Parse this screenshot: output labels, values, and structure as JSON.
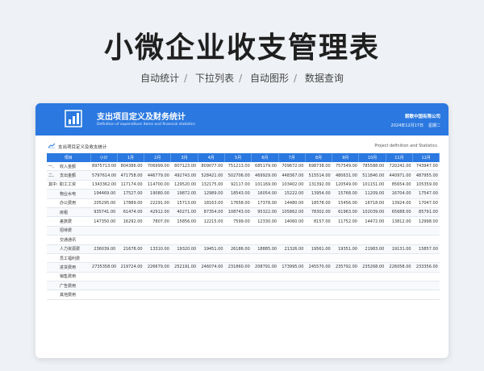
{
  "header": {
    "title": "小微企业收支管理表",
    "features": [
      "自动统计",
      "下拉列表",
      "自动图形",
      "数据查询"
    ]
  },
  "banner": {
    "title_zh": "支出项目定义及财务统计",
    "title_en": "Definition of expenditure items and financial statistics",
    "company": "朝歌中国有限公司",
    "date": "2024年12月17日",
    "weekday": "星期二"
  },
  "section": {
    "title_zh": "支出项目定义及收支统计",
    "title_en": "Project definition and Statistics"
  },
  "table": {
    "columns": [
      "项目",
      "小计",
      "1月",
      "2月",
      "3月",
      "4月",
      "5月",
      "6月",
      "7月",
      "8月",
      "9月",
      "10月",
      "11月",
      "12月"
    ],
    "rows": [
      {
        "group": "一、",
        "item": "收入金额",
        "values": [
          "8975713.00",
          "804386.00",
          "706999.00",
          "807123.00",
          "809077.00",
          "751213.00",
          "685179.00",
          "709672.00",
          "698738.00",
          "757549.00",
          "785588.00",
          "720242.00",
          "743947.00"
        ]
      },
      {
        "group": "二、",
        "item": "支出金额",
        "values": [
          "5797614.00",
          "471758.00",
          "446779.00",
          "492743.00",
          "528421.00",
          "502706.00",
          "469929.00",
          "448367.00",
          "515514.00",
          "480631.00",
          "511840.00",
          "440971.00",
          "487955.00"
        ]
      },
      {
        "group": "其中:",
        "item": "职工工资",
        "values": [
          "1343362.00",
          "117174.00",
          "114700.00",
          "129520.00",
          "132175.00",
          "92117.00",
          "101169.00",
          "103402.00",
          "131392.00",
          "120549.00",
          "101151.00",
          "85654.00",
          "105359.00"
        ]
      },
      {
        "group": "",
        "item": "物业水电",
        "values": [
          "194469.00",
          "17527.00",
          "19080.00",
          "19872.00",
          "12989.00",
          "18543.00",
          "16054.00",
          "15222.00",
          "13954.00",
          "15768.00",
          "11209.00",
          "16704.00",
          "17547.00"
        ]
      },
      {
        "group": "",
        "item": "办公费用",
        "values": [
          "205295.00",
          "17889.00",
          "22291.00",
          "15713.00",
          "18163.00",
          "17658.00",
          "17378.00",
          "14480.00",
          "18578.00",
          "15456.00",
          "16718.00",
          "13924.00",
          "17047.00"
        ]
      },
      {
        "group": "",
        "item": "房租",
        "values": [
          "935741.00",
          "61474.00",
          "42912.00",
          "40271.00",
          "87354.00",
          "108743.00",
          "95322.00",
          "105862.00",
          "78302.00",
          "61963.00",
          "102039.00",
          "65688.00",
          "85791.00"
        ]
      },
      {
        "group": "",
        "item": "差旅费",
        "values": [
          "147350.00",
          "16292.00",
          "7807.00",
          "15856.00",
          "12215.00",
          "7599.00",
          "12330.00",
          "14060.00",
          "8157.00",
          "11752.00",
          "14472.00",
          "13812.00",
          "12998.00"
        ]
      },
      {
        "group": "",
        "item": "招待费",
        "values": [
          "",
          "",
          "",
          "",
          "",
          "",
          "",
          "",
          "",
          "",
          "",
          "",
          ""
        ]
      },
      {
        "group": "",
        "item": "交通通讯",
        "values": [
          "",
          "",
          "",
          "",
          "",
          "",
          "",
          "",
          "",
          "",
          "",
          "",
          ""
        ]
      },
      {
        "group": "",
        "item": "人力资源费",
        "values": [
          "236039.00",
          "21678.00",
          "13310.00",
          "19320.00",
          "19451.00",
          "26186.00",
          "18885.00",
          "21326.00",
          "19561.00",
          "19351.00",
          "21983.00",
          "19131.00",
          "15857.00"
        ]
      },
      {
        "group": "",
        "item": "员工福利费",
        "values": [
          "",
          "",
          "",
          "",
          "",
          "",
          "",
          "",
          "",
          "",
          "",
          "",
          ""
        ]
      },
      {
        "group": "",
        "item": "进货费用",
        "values": [
          "2735358.00",
          "219724.00",
          "226679.00",
          "252191.00",
          "246074.00",
          "231860.00",
          "208791.00",
          "173995.00",
          "245570.00",
          "235792.00",
          "235268.00",
          "226058.00",
          "233356.00"
        ]
      },
      {
        "group": "",
        "item": "销售费用",
        "values": [
          "",
          "",
          "",
          "",
          "",
          "",
          "",
          "",
          "",
          "",
          "",
          "",
          ""
        ]
      },
      {
        "group": "",
        "item": "广告费用",
        "values": [
          "",
          "",
          "",
          "",
          "",
          "",
          "",
          "",
          "",
          "",
          "",
          "",
          ""
        ]
      },
      {
        "group": "",
        "item": "其他费用",
        "values": [
          "",
          "",
          "",
          "",
          "",
          "",
          "",
          "",
          "",
          "",
          "",
          "",
          ""
        ]
      }
    ]
  },
  "colors": {
    "accent": "#2a78e0",
    "background": "#eef1f5"
  }
}
